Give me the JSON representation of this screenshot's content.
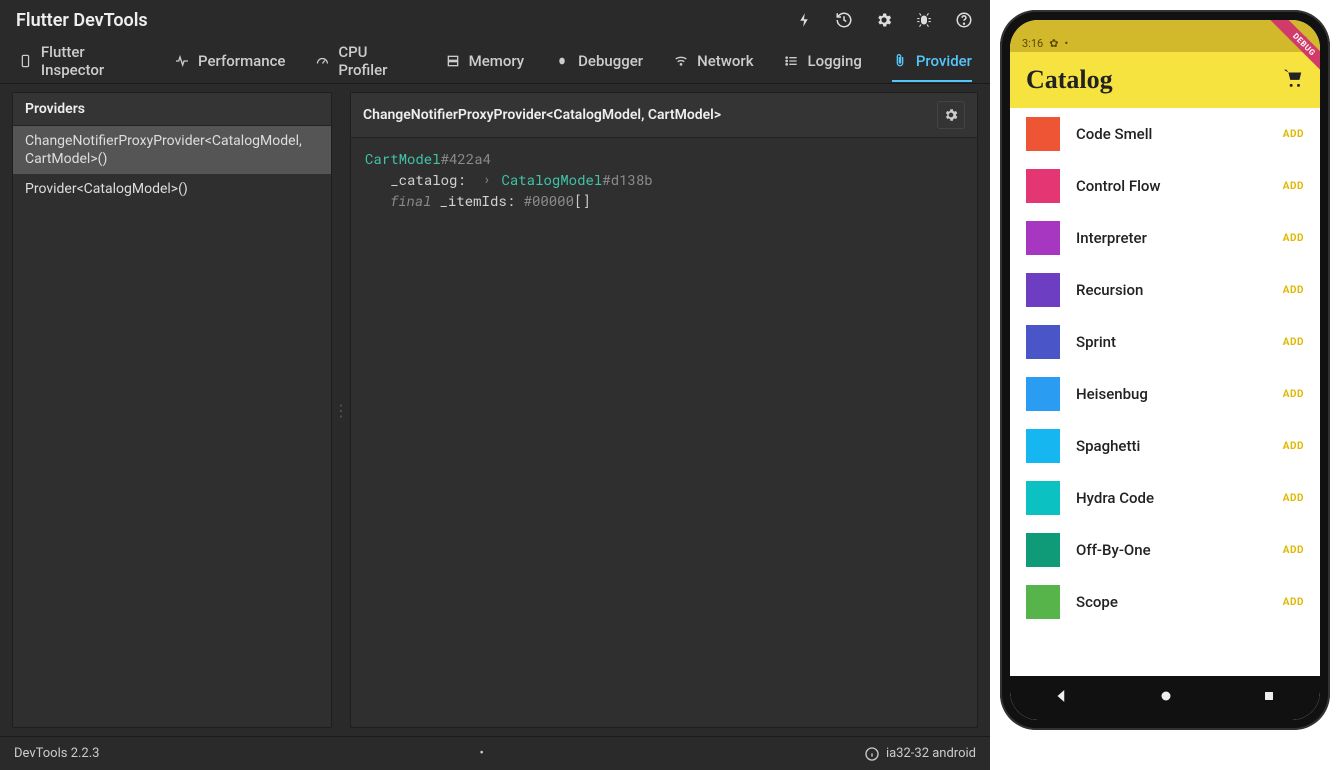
{
  "app_title": "Flutter DevTools",
  "tabs": [
    {
      "label": "Flutter Inspector",
      "icon": "phone-icon"
    },
    {
      "label": "Performance",
      "icon": "pulse-icon"
    },
    {
      "label": "CPU Profiler",
      "icon": "gauge-icon"
    },
    {
      "label": "Memory",
      "icon": "stack-icon"
    },
    {
      "label": "Debugger",
      "icon": "bug2-icon"
    },
    {
      "label": "Network",
      "icon": "wifi-icon"
    },
    {
      "label": "Logging",
      "icon": "list-icon"
    },
    {
      "label": "Provider",
      "icon": "attach-icon",
      "active": true
    }
  ],
  "providers_panel": {
    "title": "Providers",
    "items": [
      "ChangeNotifierProxyProvider<CatalogModel, CartModel>()",
      "Provider<CatalogModel>()"
    ],
    "selected_index": 0
  },
  "detail_panel": {
    "title": "ChangeNotifierProxyProvider<CatalogModel, CartModel>",
    "root_type": "CartModel",
    "root_hash": "#422a4",
    "catalog_key": "_catalog:",
    "catalog_type": "CatalogModel",
    "catalog_hash": "#d138b",
    "item_modifier": "final ",
    "item_key": "_itemIds:",
    "item_hash": "#00000",
    "item_value": "[]"
  },
  "footer": {
    "version": "DevTools 2.2.3",
    "dot": "•",
    "platform": "ia32-32 android"
  },
  "emulator": {
    "debug_label": "DEBUG",
    "time": "3:16",
    "app_bar_title": "Catalog",
    "add_label": "ADD",
    "items": [
      {
        "name": "Code Smell",
        "color": "#ed5534"
      },
      {
        "name": "Control Flow",
        "color": "#e53674"
      },
      {
        "name": "Interpreter",
        "color": "#a737c0"
      },
      {
        "name": "Recursion",
        "color": "#6d3ec1"
      },
      {
        "name": "Sprint",
        "color": "#4a55c8"
      },
      {
        "name": "Heisenbug",
        "color": "#2a9cf2"
      },
      {
        "name": "Spaghetti",
        "color": "#16b6f0"
      },
      {
        "name": "Hydra Code",
        "color": "#0bc1c1"
      },
      {
        "name": "Off-By-One",
        "color": "#0f9a78"
      },
      {
        "name": "Scope",
        "color": "#56b44b"
      }
    ]
  }
}
